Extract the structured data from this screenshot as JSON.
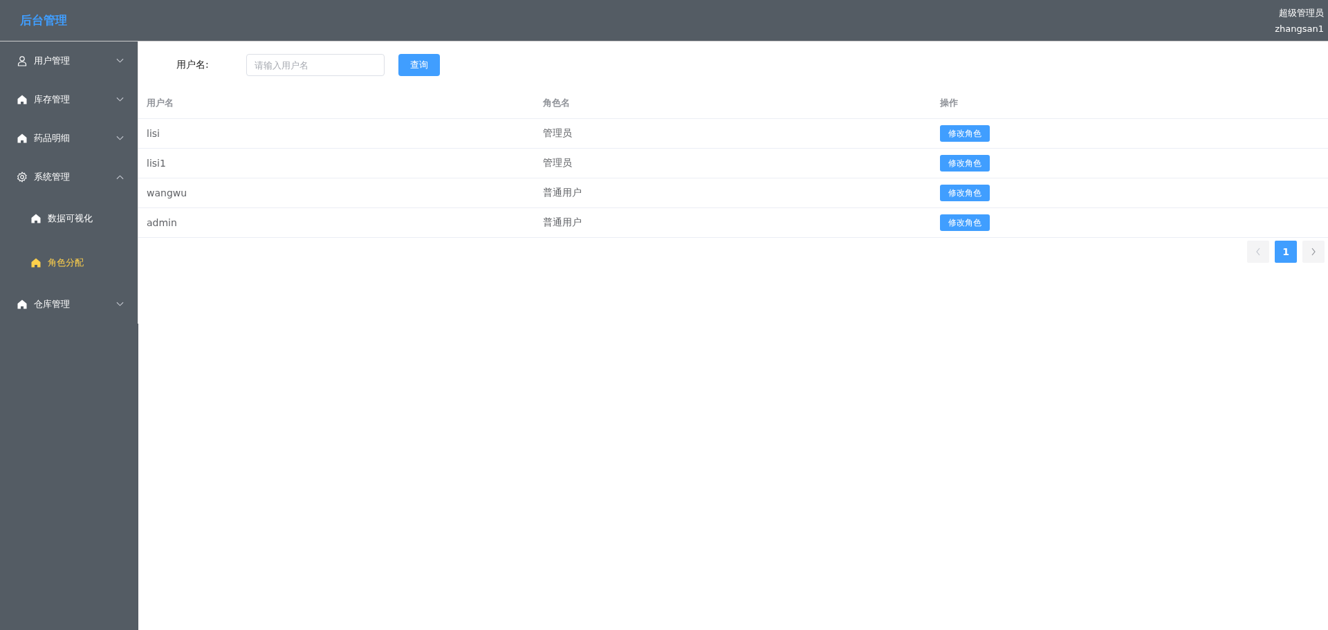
{
  "header": {
    "logo": "后台管理",
    "role": "超级管理员",
    "username": "zhangsan1"
  },
  "sidebar": {
    "items": [
      {
        "label": "用户管理",
        "expanded": false
      },
      {
        "label": "库存管理",
        "expanded": false
      },
      {
        "label": "药品明细",
        "expanded": false
      },
      {
        "label": "系统管理",
        "expanded": true,
        "children": [
          {
            "label": "数据可视化",
            "selected": false
          },
          {
            "label": "角色分配",
            "selected": true
          }
        ]
      },
      {
        "label": "仓库管理",
        "expanded": false
      }
    ]
  },
  "search": {
    "label": "用户名:",
    "placeholder": "请输入用户名",
    "button": "查询"
  },
  "table": {
    "columns": [
      "用户名",
      "角色名",
      "操作"
    ],
    "rows": [
      {
        "username": "lisi",
        "role": "管理员",
        "action": "修改角色"
      },
      {
        "username": "lisi1",
        "role": "管理员",
        "action": "修改角色"
      },
      {
        "username": "wangwu",
        "role": "普通用户",
        "action": "修改角色"
      },
      {
        "username": "admin",
        "role": "普通用户",
        "action": "修改角色"
      }
    ]
  },
  "pagination": {
    "pages": [
      {
        "label": "1",
        "selected": true
      }
    ]
  }
}
